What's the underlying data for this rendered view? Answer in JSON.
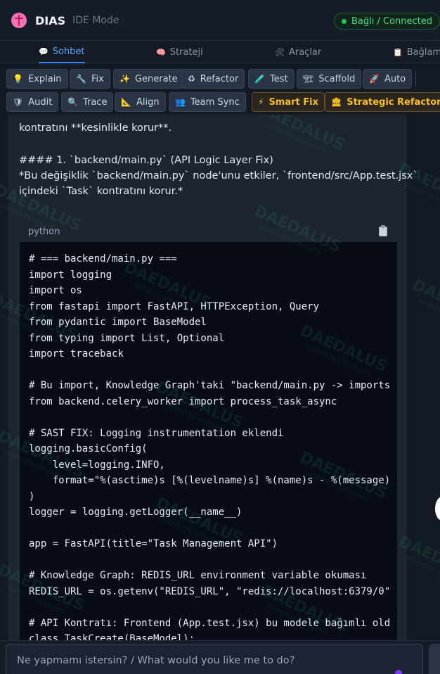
{
  "header": {
    "title": "DIAS",
    "mode": "IDE Mode",
    "status": "Bağlı / Connected",
    "brand_icon": "brain-icon",
    "status_color": "#4ade80"
  },
  "tabs": [
    {
      "label": "Sohbet",
      "icon": "chat-bubble-icon",
      "active": true
    },
    {
      "label": "Strateji",
      "icon": "brain-icon"
    },
    {
      "label": "Araçlar",
      "icon": "tools-icon"
    },
    {
      "label": "Bağlam",
      "icon": "clipboard-icon"
    }
  ],
  "toolbar": {
    "buttons": [
      {
        "label": "Explain",
        "icon": "lightbulb-icon",
        "glyph": "💡"
      },
      {
        "label": "Fix",
        "icon": "wrench-icon",
        "glyph": "🔧"
      },
      {
        "label": "Generate",
        "icon": "sparkles-icon",
        "glyph": "✨"
      },
      {
        "label": "Refactor",
        "icon": "recycle-icon",
        "glyph": "♻"
      },
      {
        "label": "Test",
        "icon": "test-tube-icon",
        "glyph": "🧪"
      },
      {
        "label": "Scaffold",
        "icon": "scaffold-icon",
        "glyph": "🏗"
      },
      {
        "label": "Auto",
        "icon": "rocket-icon",
        "glyph": "🚀"
      },
      {
        "label": "Audit",
        "icon": "shield-icon",
        "glyph": "🛡"
      },
      {
        "label": "Trace",
        "icon": "magnifier-icon",
        "glyph": "🔍"
      },
      {
        "label": "Align",
        "icon": "ruler-icon",
        "glyph": "📐"
      },
      {
        "label": "Team Sync",
        "icon": "team-icon",
        "glyph": "👥"
      }
    ],
    "special": [
      {
        "label": "Smart Fix",
        "icon": "lightning-icon",
        "glyph": "⚡"
      },
      {
        "label": "Strategic Refactor",
        "icon": "classical-building-icon",
        "glyph": "🏛"
      }
    ],
    "accent_color": "#fbbf24"
  },
  "message": {
    "lines": [
      "kontratını **kesinlikle korur**.",
      "#### 1. `backend/main.py` (API Logic Layer Fix)",
      "*Bu değişiklik `backend/main.py` node'unu etkiler, `frontend/src/App.test.jsx`",
      "içindeki `Task` kontratını korur.*"
    ],
    "code_lang": "python",
    "copy_icon": "clipboard-icon",
    "code": [
      "# === backend/main.py ===",
      "import logging",
      "import os",
      "from fastapi import FastAPI, HTTPException, Query",
      "from pydantic import BaseModel",
      "from typing import List, Optional",
      "import traceback",
      "",
      "# Bu import, Knowledge Graph'taki \"backend/main.py -> imports",
      "from backend.celery_worker import process_task_async",
      "",
      "# SAST FIX: Logging instrumentation eklendi",
      "logging.basicConfig(",
      "    level=logging.INFO,",
      "    format=\"%(asctime)s [%(levelname)s] %(name)s - %(message)",
      ")",
      "logger = logging.getLogger(__name__)",
      "",
      "app = FastAPI(title=\"Task Management API\")",
      "",
      "# Knowledge Graph: REDIS_URL environment variable okuması",
      "REDIS_URL = os.getenv(\"REDIS_URL\", \"redis://localhost:6379/0\"",
      "",
      "# API Kontratı: Frontend (App.test.jsx) bu modele bağımlı old",
      "class TaskCreate(BaseModel):"
    ]
  },
  "watermark": {
    "brand": "DAEDALUS",
    "sub": "intellecta.solutions"
  },
  "input": {
    "placeholder": "Ne yapmamı istersin? / What would you like me to do?"
  }
}
